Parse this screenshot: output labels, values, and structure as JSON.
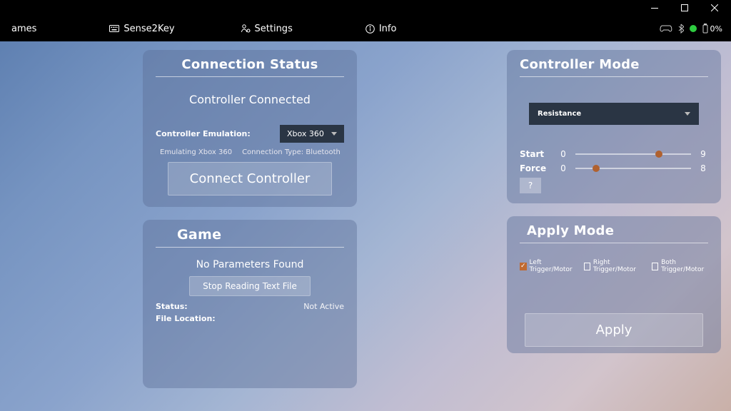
{
  "titlebar": {
    "min": "—",
    "max": "▢",
    "close": "✕"
  },
  "menu": {
    "games": "ames",
    "sense2key": "Sense2Key",
    "settings": "Settings",
    "info": "Info",
    "battery": "0%"
  },
  "connection": {
    "title": "Connection Status",
    "status": "Controller Connected",
    "emulation_label": "Controller Emulation:",
    "emulation_value": "Xbox 360",
    "emulating": "Emulating Xbox 360",
    "conn_type": "Connection Type: Bluetooth",
    "button": "Connect Controller"
  },
  "game": {
    "title": "Game",
    "params": "No Parameters Found",
    "button": "Stop Reading Text File",
    "status_label": "Status:",
    "status_value": "Not Active",
    "location_label": "File Location:"
  },
  "mode": {
    "title": "Controller Mode",
    "select": "Resistance",
    "sliders": {
      "start": {
        "label": "Start",
        "min": "0",
        "max": "9",
        "pct": 72
      },
      "force": {
        "label": "Force",
        "min": "0",
        "max": "8",
        "pct": 18
      }
    },
    "help": "?"
  },
  "apply": {
    "title": "Apply Mode",
    "checks": {
      "left": "Left Trigger/Motor",
      "right": "Right Trigger/Motor",
      "both": "Both Trigger/Motor"
    },
    "button": "Apply"
  }
}
